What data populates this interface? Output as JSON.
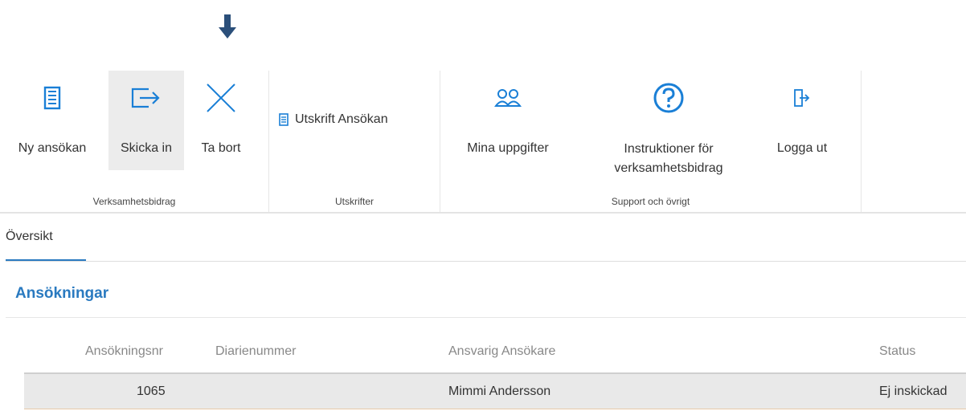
{
  "ribbon": {
    "groups": [
      {
        "label": "Verksamhetsbidrag",
        "buttons": [
          {
            "label": "Ny ansökan",
            "icon": "document-icon"
          },
          {
            "label": "Skicka in",
            "icon": "send-icon",
            "active": true
          },
          {
            "label": "Ta bort",
            "icon": "close-icon"
          }
        ]
      },
      {
        "label": "Utskrifter",
        "buttons": [
          {
            "label": "Utskrift Ansökan",
            "icon": "print-document-icon"
          }
        ]
      },
      {
        "label": "Support och övrigt",
        "buttons": [
          {
            "label": "Mina uppgifter",
            "icon": "users-icon"
          },
          {
            "label": "Instruktioner för verksamhetsbidrag",
            "icon": "help-icon"
          },
          {
            "label": "Logga ut",
            "icon": "logout-icon"
          }
        ]
      }
    ]
  },
  "tabs": [
    {
      "label": "Översikt",
      "active": true
    }
  ],
  "section": {
    "title": "Ansökningar"
  },
  "table": {
    "columns": [
      "Ansökningsnr",
      "Diarienummer",
      "Ansvarig Ansökare",
      "Status"
    ],
    "rows": [
      {
        "nr": "1065",
        "diarienummer": "",
        "ansokare": "Mimmi Andersson",
        "status": "Ej inskickad"
      }
    ]
  },
  "colors": {
    "accent": "#2a7ac0",
    "icon_blue": "#1a7fd6",
    "active_bg": "#ececec",
    "pointer": "#2b4f7a"
  }
}
